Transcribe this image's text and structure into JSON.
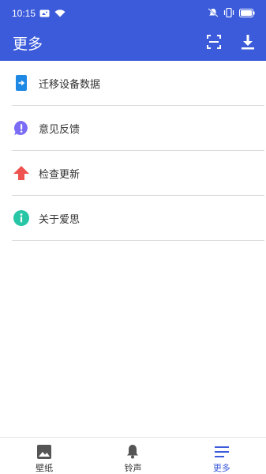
{
  "status_bar": {
    "time": "10:15",
    "left_icons": [
      "image-icon",
      "wifi-icon"
    ],
    "right_icons": [
      "mute-icon",
      "vibrate-icon",
      "battery-icon"
    ]
  },
  "header": {
    "title": "更多",
    "actions": [
      "scan-icon",
      "download-icon"
    ],
    "color": "#3b5bdb"
  },
  "menu": {
    "items": [
      {
        "label": "迁移设备数据",
        "icon": "transfer-icon",
        "icon_color": "#1e88e5"
      },
      {
        "label": "意见反馈",
        "icon": "feedback-icon",
        "icon_color": "#7b6cf6"
      },
      {
        "label": "检查更新",
        "icon": "update-arrow-icon",
        "icon_color": "#ef5350"
      },
      {
        "label": "关于爱思",
        "icon": "info-icon",
        "icon_color": "#26c6a6"
      }
    ]
  },
  "bottom_nav": {
    "items": [
      {
        "label": "壁纸",
        "icon": "wallpaper-icon"
      },
      {
        "label": "铃声",
        "icon": "bell-icon"
      },
      {
        "label": "更多",
        "icon": "menu-lines-icon"
      }
    ],
    "active": "更多",
    "active_color": "#3b5bdb"
  }
}
